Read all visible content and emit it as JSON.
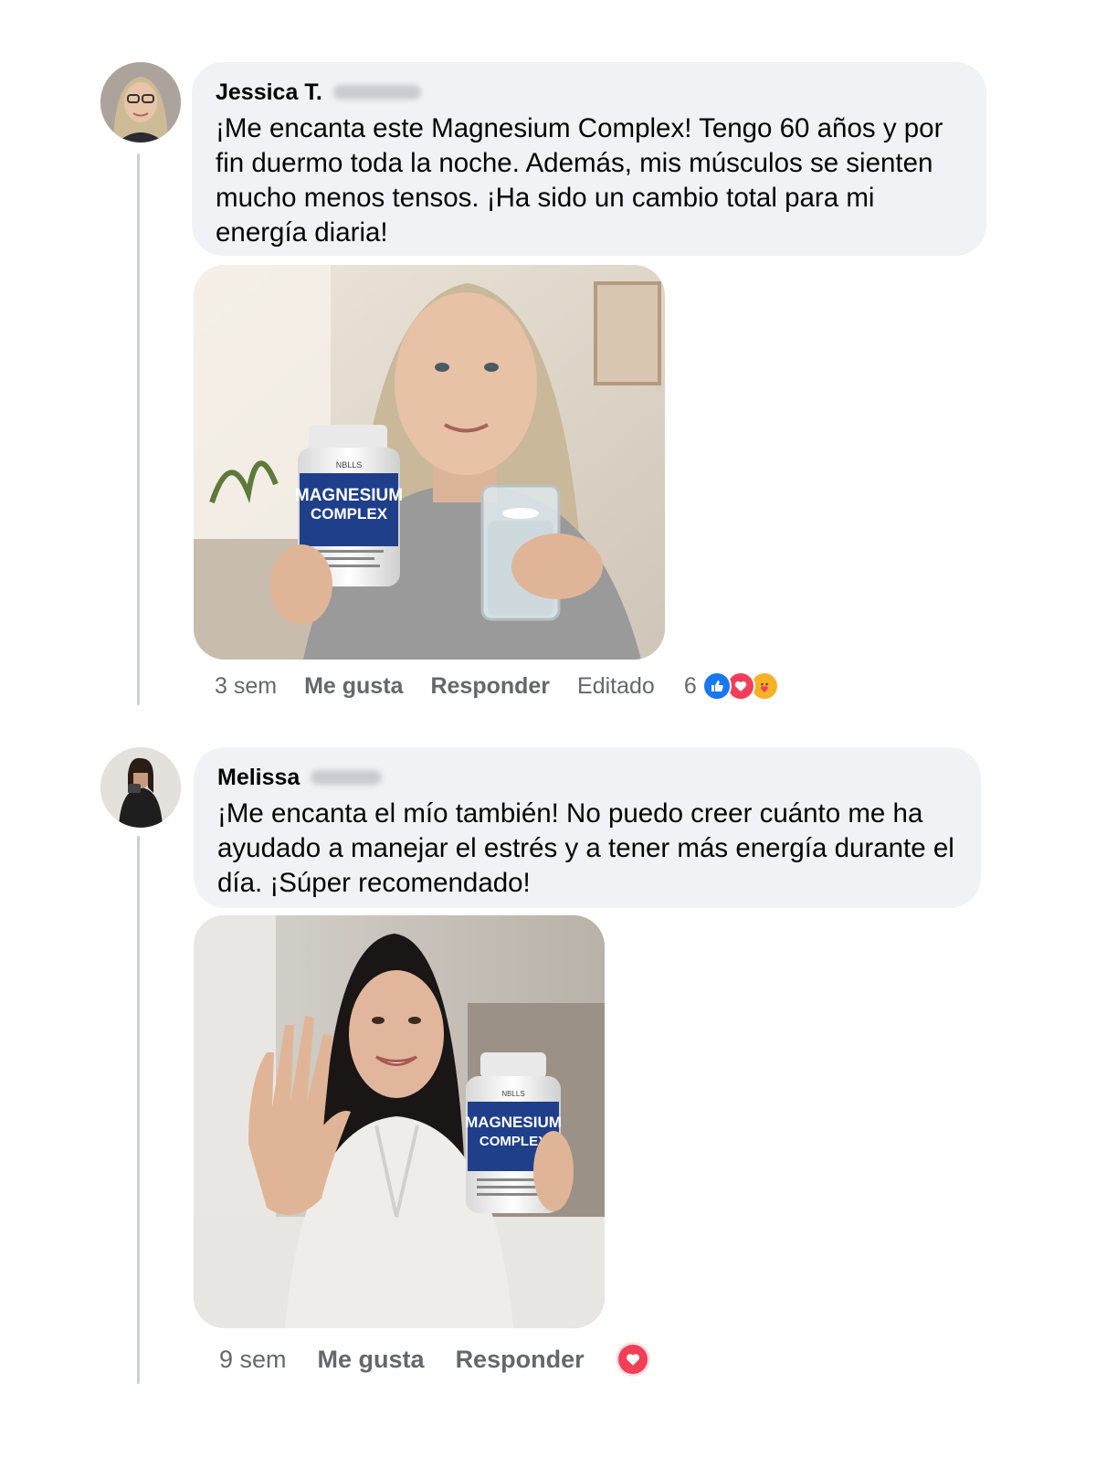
{
  "comments": [
    {
      "author": "Jessica T.",
      "text": "¡Me encanta este Magnesium Complex! Tengo 60 años y por fin duermo toda la noche. Además, mis músculos se sienten mucho menos tensos. ¡Ha sido un cambio total para mi energía diaria!",
      "photo": {
        "bottle_brand": "NBLLS",
        "bottle_line1": "MAGNESIUM",
        "bottle_line2": "COMPLEX"
      },
      "time": "3 sem",
      "like_label": "Me gusta",
      "reply_label": "Responder",
      "edited_label": "Editado",
      "reaction_count": "6",
      "reactions": [
        "like-icon",
        "love-icon",
        "care-icon"
      ]
    },
    {
      "author": "Melissa",
      "text": "¡Me encanta el mío también! No puedo creer cuánto me ha ayudado a manejar el estrés y a tener más energía durante el día. ¡Súper recomendado!",
      "photo": {
        "bottle_brand": "NBLLS",
        "bottle_line1": "MAGNESIUM",
        "bottle_line2": "COMPLEX"
      },
      "time": "9 sem",
      "like_label": "Me gusta",
      "reply_label": "Responder",
      "reactions": [
        "love-icon"
      ]
    }
  ],
  "colors": {
    "bubble": "#f0f2f5",
    "meta_text": "#65676b",
    "like_blue": "#1877f2",
    "love_red": "#f33e58",
    "care_yellow": "#f7b125"
  }
}
